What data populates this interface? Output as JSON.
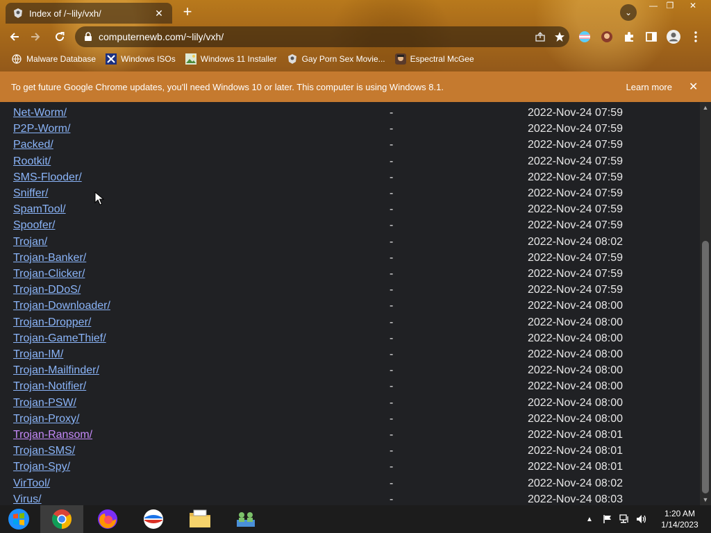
{
  "browser": {
    "tab_title": "Index of /~lily/vxh/",
    "tab_close": "✕",
    "new_tab": "+",
    "url": "computernewb.com/~lily/vxh/",
    "window_controls": {
      "minimize": "—",
      "maximize": "❐",
      "close": "✕"
    }
  },
  "bookmarks": [
    {
      "label": "Malware Database",
      "icon": "globe-icon"
    },
    {
      "label": "Windows ISOs",
      "icon": "x-logo-icon"
    },
    {
      "label": "Windows 11 Installer",
      "icon": "image-icon"
    },
    {
      "label": "Gay Porn Sex Movie...",
      "icon": "shield-icon"
    },
    {
      "label": "Espectral McGee",
      "icon": "avatar-icon"
    }
  ],
  "infobar": {
    "message": "To get future Google Chrome updates, you'll need Windows 10 or later. This computer is using Windows 8.1.",
    "learn_more": "Learn more",
    "close": "✕"
  },
  "listing": [
    {
      "name": "Net-Worm/",
      "size": "-",
      "date": "2022-Nov-24 07:59"
    },
    {
      "name": "P2P-Worm/",
      "size": "-",
      "date": "2022-Nov-24 07:59"
    },
    {
      "name": "Packed/",
      "size": "-",
      "date": "2022-Nov-24 07:59"
    },
    {
      "name": "Rootkit/",
      "size": "-",
      "date": "2022-Nov-24 07:59"
    },
    {
      "name": "SMS-Flooder/",
      "size": "-",
      "date": "2022-Nov-24 07:59"
    },
    {
      "name": "Sniffer/",
      "size": "-",
      "date": "2022-Nov-24 07:59"
    },
    {
      "name": "SpamTool/",
      "size": "-",
      "date": "2022-Nov-24 07:59"
    },
    {
      "name": "Spoofer/",
      "size": "-",
      "date": "2022-Nov-24 07:59"
    },
    {
      "name": "Trojan/",
      "size": "-",
      "date": "2022-Nov-24 08:02"
    },
    {
      "name": "Trojan-Banker/",
      "size": "-",
      "date": "2022-Nov-24 07:59"
    },
    {
      "name": "Trojan-Clicker/",
      "size": "-",
      "date": "2022-Nov-24 07:59"
    },
    {
      "name": "Trojan-DDoS/",
      "size": "-",
      "date": "2022-Nov-24 07:59"
    },
    {
      "name": "Trojan-Downloader/",
      "size": "-",
      "date": "2022-Nov-24 08:00"
    },
    {
      "name": "Trojan-Dropper/",
      "size": "-",
      "date": "2022-Nov-24 08:00"
    },
    {
      "name": "Trojan-GameThief/",
      "size": "-",
      "date": "2022-Nov-24 08:00"
    },
    {
      "name": "Trojan-IM/",
      "size": "-",
      "date": "2022-Nov-24 08:00"
    },
    {
      "name": "Trojan-Mailfinder/",
      "size": "-",
      "date": "2022-Nov-24 08:00"
    },
    {
      "name": "Trojan-Notifier/",
      "size": "-",
      "date": "2022-Nov-24 08:00"
    },
    {
      "name": "Trojan-PSW/",
      "size": "-",
      "date": "2022-Nov-24 08:00"
    },
    {
      "name": "Trojan-Proxy/",
      "size": "-",
      "date": "2022-Nov-24 08:00"
    },
    {
      "name": "Trojan-Ransom/",
      "size": "-",
      "date": "2022-Nov-24 08:01",
      "visited": true
    },
    {
      "name": "Trojan-SMS/",
      "size": "-",
      "date": "2022-Nov-24 08:01"
    },
    {
      "name": "Trojan-Spy/",
      "size": "-",
      "date": "2022-Nov-24 08:01"
    },
    {
      "name": "VirTool/",
      "size": "-",
      "date": "2022-Nov-24 08:02"
    },
    {
      "name": "Virus/",
      "size": "-",
      "date": "2022-Nov-24 08:03"
    }
  ],
  "taskbar": {
    "apps": [
      {
        "name": "Start",
        "icon": "windows-start-icon"
      },
      {
        "name": "Google Chrome",
        "icon": "chrome-icon",
        "active": true
      },
      {
        "name": "Firefox",
        "icon": "firefox-icon"
      },
      {
        "name": "Opera",
        "icon": "opera-icon"
      },
      {
        "name": "File Explorer",
        "icon": "folder-icon"
      },
      {
        "name": "Network",
        "icon": "network-users-icon"
      }
    ],
    "clock": {
      "time": "1:20 AM",
      "date": "1/14/2023"
    }
  },
  "colors": {
    "link": "#8ab4f8",
    "visited_link": "#c58af9",
    "page_bg": "#202124",
    "infobar_bg": "#c57a2f"
  }
}
